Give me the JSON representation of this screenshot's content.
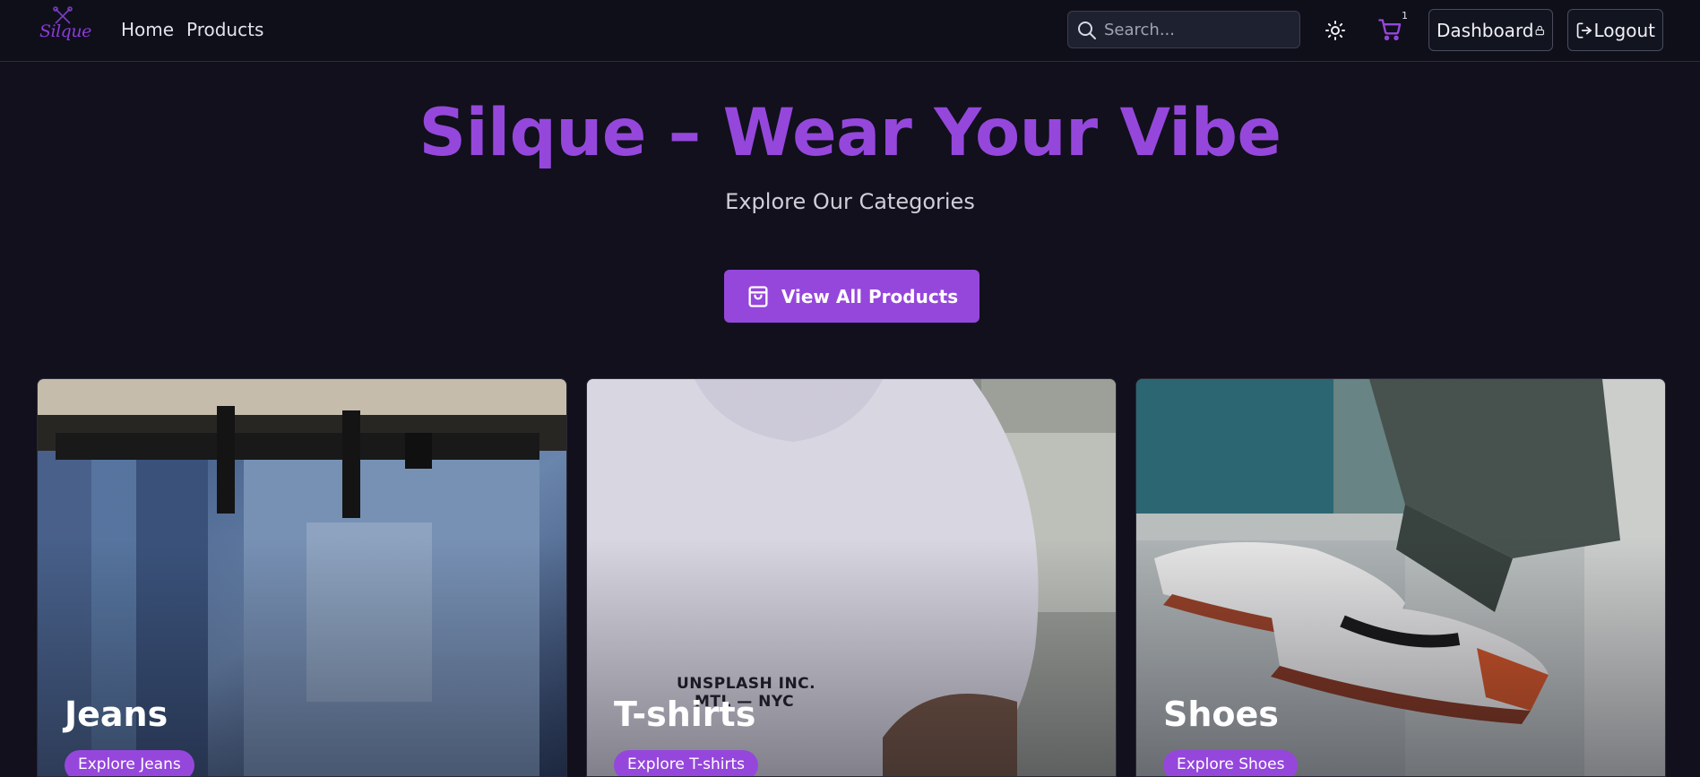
{
  "header": {
    "logo": "Silque",
    "nav": [
      "Home",
      "Products"
    ],
    "search_placeholder": "Search...",
    "cart_count": "1",
    "dashboard_label": "Dashboard",
    "logout_label": "Logout"
  },
  "hero": {
    "title": "Silque – Wear Your Vibe",
    "subtitle": "Explore Our Categories",
    "cta_label": "View All Products"
  },
  "categories": [
    {
      "title": "Jeans",
      "button": "Explore Jeans"
    },
    {
      "title": "T-shirts",
      "button": "Explore T-shirts"
    },
    {
      "title": "Shoes",
      "button": "Explore Shoes"
    }
  ],
  "tshirt_print": [
    "UNSPLASH INC.",
    "MTL — NYC"
  ],
  "colors": {
    "accent": "#9547dc",
    "background": "#11101c",
    "navbar": "#0f0f1a"
  }
}
